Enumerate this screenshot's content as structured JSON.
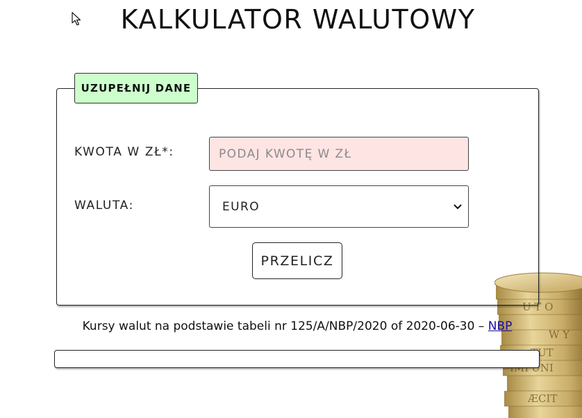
{
  "page": {
    "title": "KALKULATOR WALUTOWY"
  },
  "form": {
    "legend": "UZUPEŁNIJ DANE",
    "amount_label": "KWOTA W ZŁ*:",
    "amount_placeholder": "PODAJ KWOTĘ W ZŁ",
    "amount_value": "",
    "currency_label": "WALUTA:",
    "currency_selected": "EURO",
    "submit_label": "PRZELICZ"
  },
  "footer": {
    "rates_text": "Kursy walut na podstawie tabeli nr 125/A/NBP/2020 of 2020-06-30 – ",
    "source_link": "NBP"
  },
  "result": {
    "text": ""
  },
  "icons": {
    "cursor": "mouse-pointer-icon",
    "dropdown": "chevron-down-icon",
    "decoration": "coin-stack-image"
  },
  "colors": {
    "legend_bg": "#ccffcc",
    "input_error_bg": "#ffe4e4",
    "link": "#1a0dab"
  }
}
